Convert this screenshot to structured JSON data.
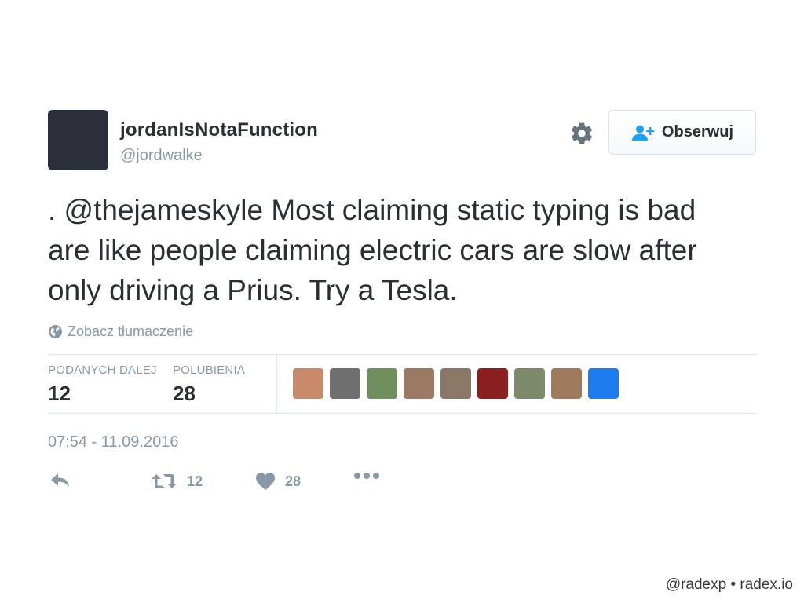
{
  "tweet": {
    "user": {
      "name": "jordanIsNotaFunction",
      "handle": "@jordwalke",
      "avatar_color": "#2b2f3a"
    },
    "follow_button": {
      "label": "Obserwuj",
      "icon": "add-user-icon"
    },
    "settings_icon": "gear-icon",
    "text": ". @thejameskyle Most claiming static typing is bad are like people claiming electric cars are slow after only driving a Prius. Try a Tesla.",
    "translate": {
      "icon": "globe-icon",
      "label": "Zobacz tłumaczenie"
    },
    "stats": {
      "retweets": {
        "label": "PODANYCH DALEJ",
        "value": "12"
      },
      "likes": {
        "label": "POLUBIENIA",
        "value": "28"
      }
    },
    "likers": [
      {
        "color": "#c98a6b"
      },
      {
        "color": "#6f6f6f"
      },
      {
        "color": "#6f8f5e"
      },
      {
        "color": "#9a7a62"
      },
      {
        "color": "#8a7766"
      },
      {
        "color": "#8a1f1f"
      },
      {
        "color": "#7d8a6a"
      },
      {
        "color": "#a07a5f"
      },
      {
        "color": "#1d7bf0"
      }
    ],
    "timestamp": "07:54 - 11.09.2016",
    "actions": {
      "reply": {
        "icon": "reply-icon"
      },
      "retweet": {
        "icon": "retweet-icon",
        "count": "12"
      },
      "like": {
        "icon": "heart-icon",
        "count": "28"
      },
      "more": {
        "icon": "more-icon"
      }
    },
    "accent_color": "#1da1f2"
  },
  "footer": "@radexp • radex.io"
}
